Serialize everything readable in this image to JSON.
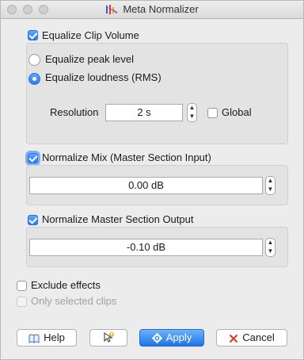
{
  "window": {
    "title": "Meta Normalizer"
  },
  "clip_volume": {
    "label": "Equalize Clip Volume",
    "checked": true,
    "peak_label": "Equalize peak level",
    "rms_label": "Equalize loudness (RMS)",
    "selected_mode": "rms",
    "resolution_label": "Resolution",
    "resolution_value": "2 s",
    "global_label": "Global",
    "global_checked": false
  },
  "normalize_mix": {
    "label": "Normalize Mix (Master Section Input)",
    "checked": true,
    "value": "0.00 dB"
  },
  "normalize_master": {
    "label": "Normalize Master Section Output",
    "checked": true,
    "value": "-0.10 dB"
  },
  "options": {
    "exclude_effects_label": "Exclude effects",
    "exclude_effects_checked": false,
    "only_selected_label": "Only selected clips",
    "only_selected_enabled": false
  },
  "buttons": {
    "help": "Help",
    "apply": "Apply",
    "cancel": "Cancel"
  },
  "colors": {
    "accent": "#2a7cf2",
    "cancel_icon": "#e03a2b"
  }
}
